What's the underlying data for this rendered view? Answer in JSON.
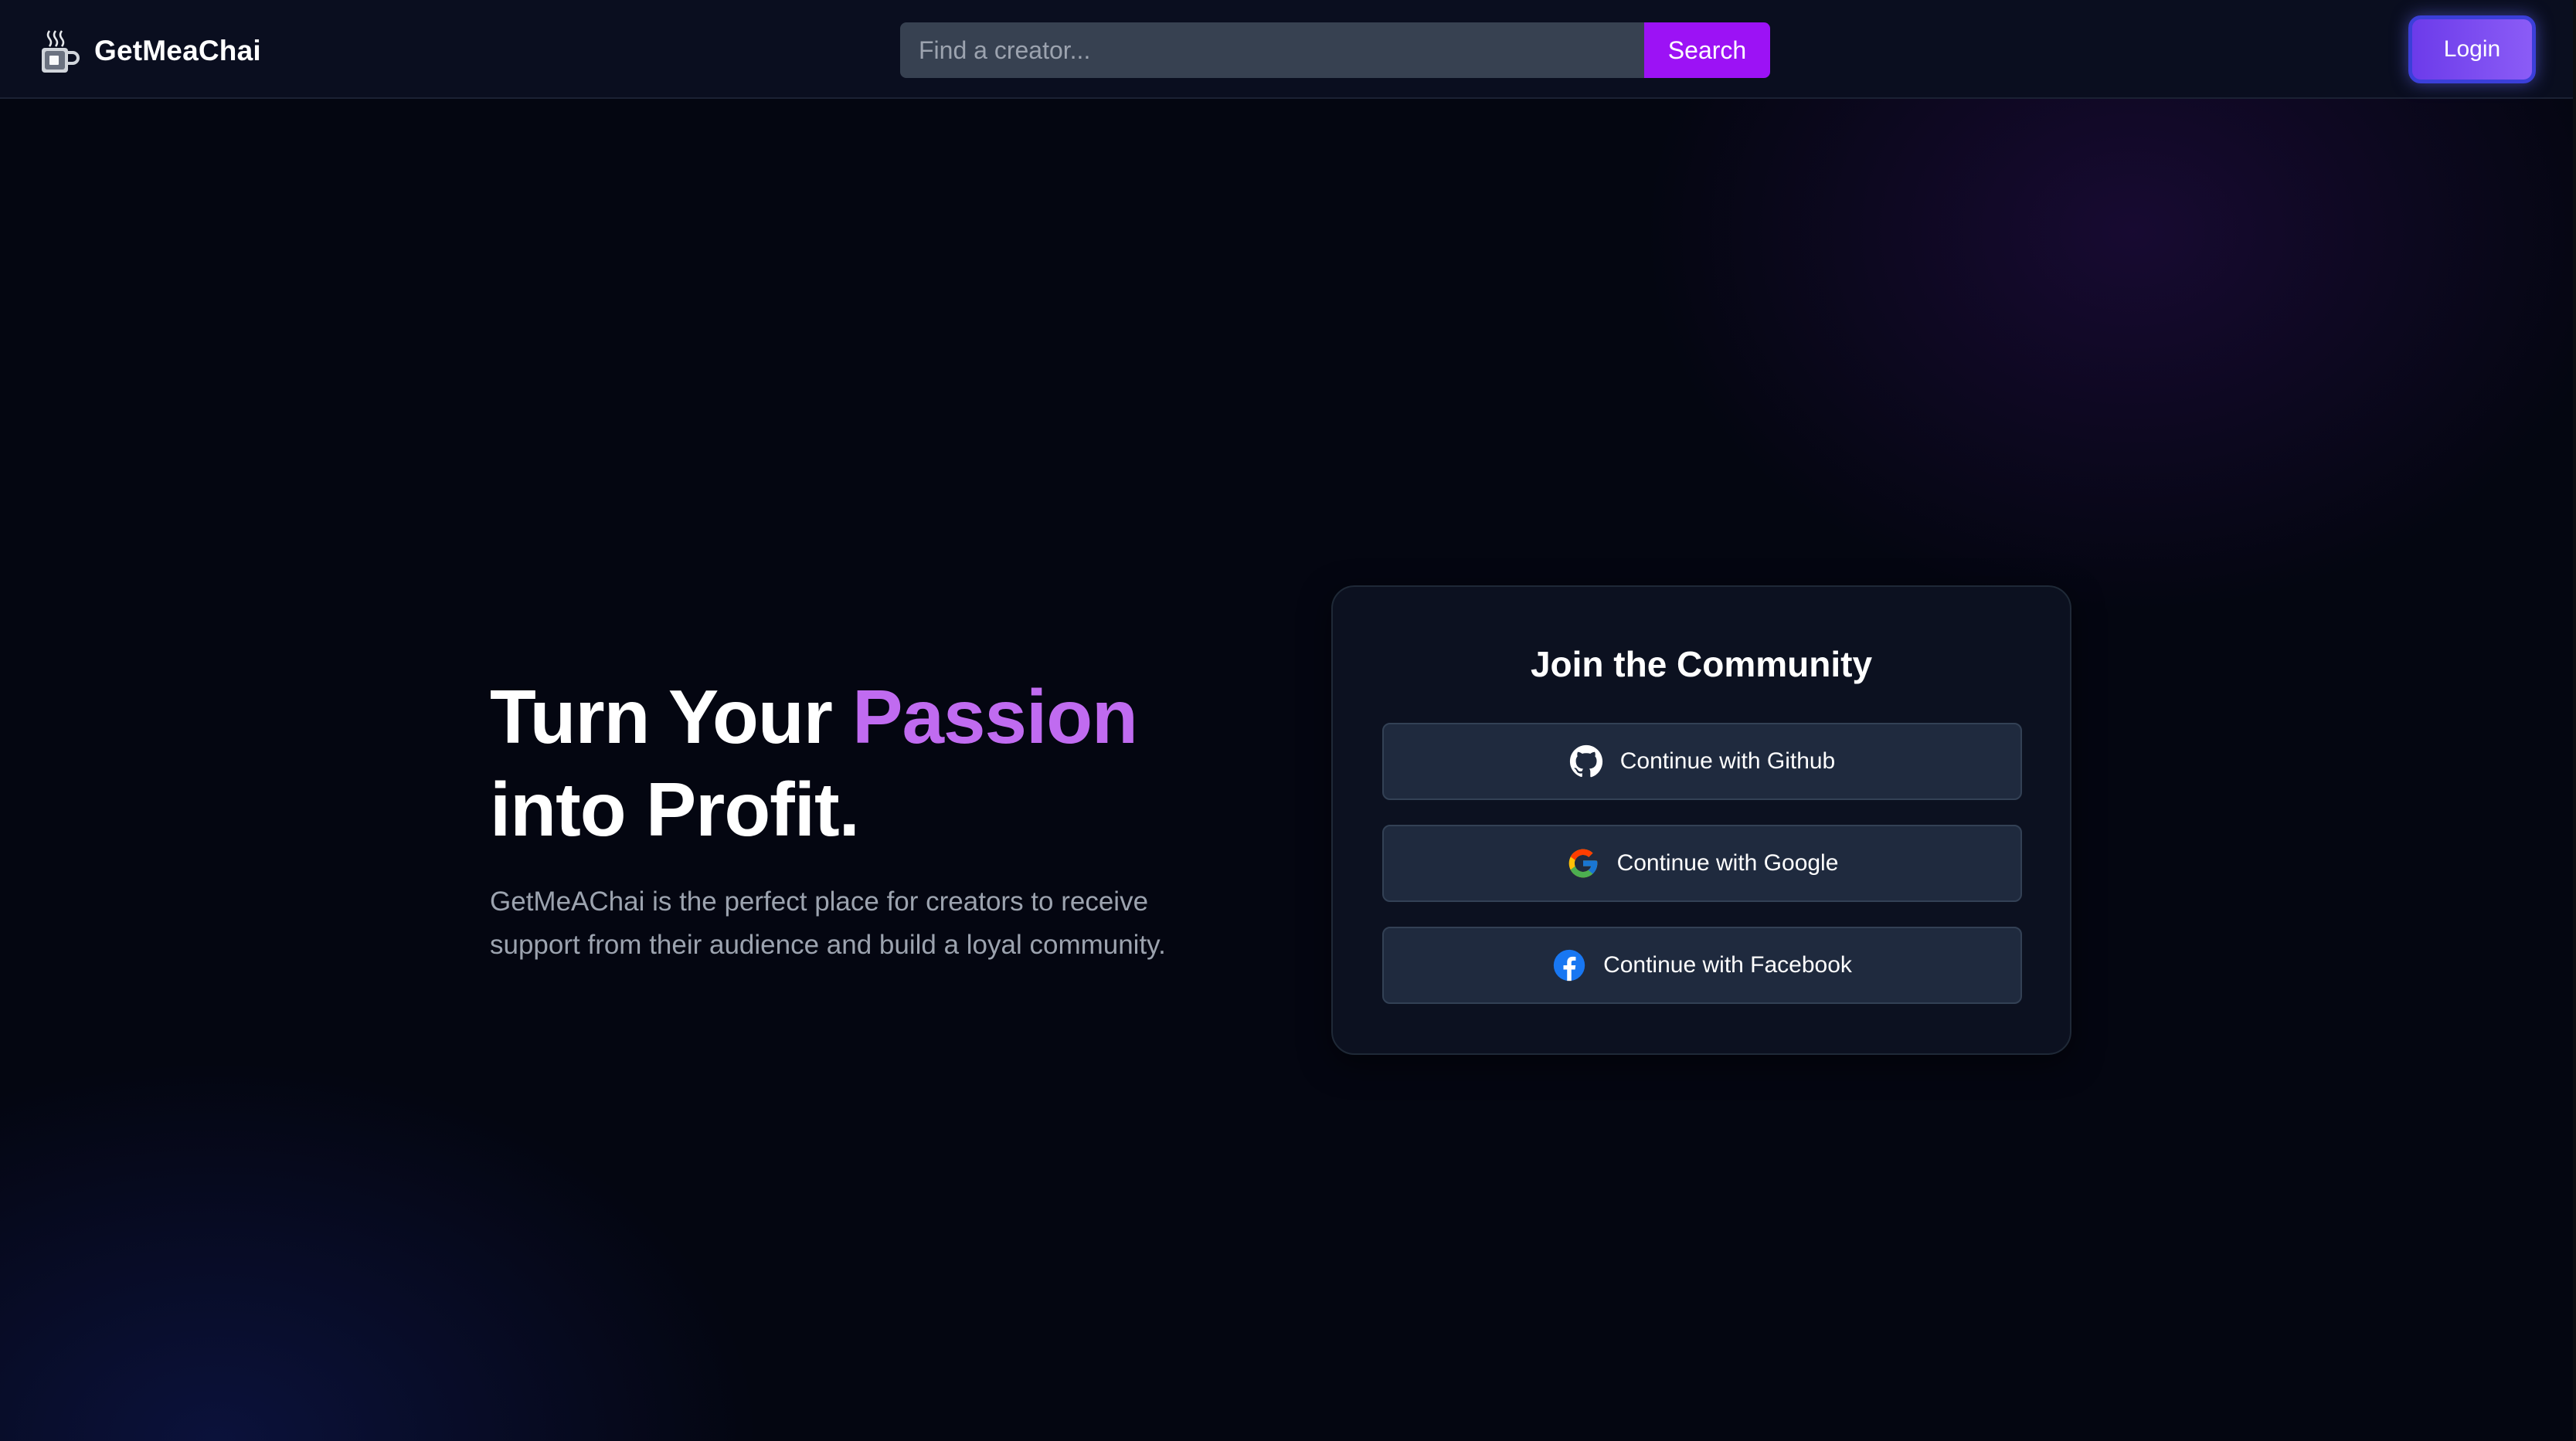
{
  "navbar": {
    "brand_name": "GetMeaChai",
    "search": {
      "placeholder": "Find a creator...",
      "value": "",
      "button_label": "Search"
    },
    "login_label": "Login"
  },
  "hero": {
    "title_part1": "Turn Your ",
    "title_accent": "Passion",
    "title_line2": "into Profit.",
    "description": "GetMeAChai is the perfect place for creators to receive support from their audience and build a loyal community."
  },
  "auth_card": {
    "title": "Join the Community",
    "buttons": [
      {
        "label": "Continue with Github",
        "icon": "github-icon"
      },
      {
        "label": "Continue with Google",
        "icon": "google-icon"
      },
      {
        "label": "Continue with Facebook",
        "icon": "facebook-icon"
      }
    ]
  },
  "colors": {
    "background": "#040611",
    "navbar": "#0a0e1f",
    "accent_purple": "#c06bf0",
    "search_button": "#9c12f5",
    "login_button": "#7c4dff",
    "card_background": "#0c1120",
    "auth_button": "#1f2a3e",
    "description_text": "#9ca3af"
  }
}
